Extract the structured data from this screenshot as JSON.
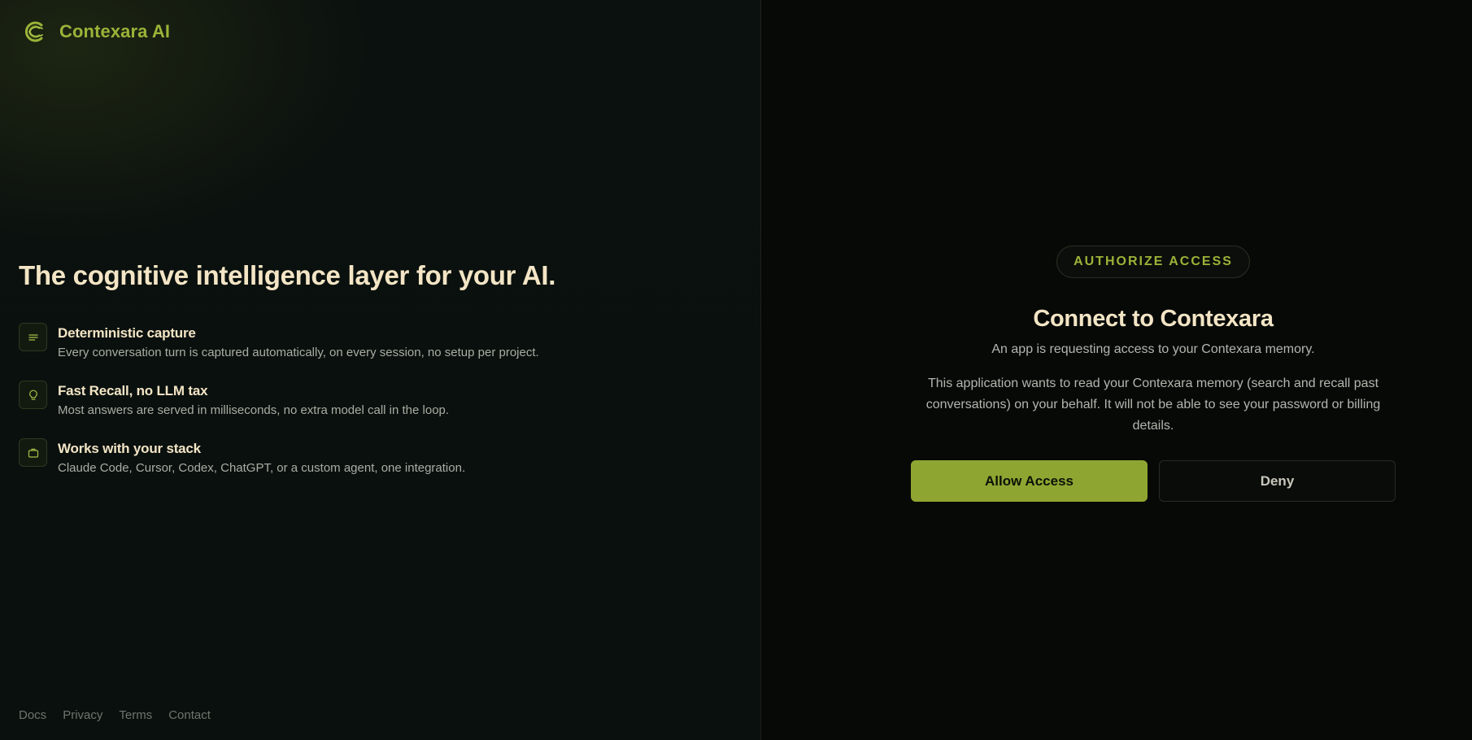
{
  "brand": {
    "name": "Contexara AI",
    "color": "#9bb338"
  },
  "hero": {
    "headline": "The cognitive intelligence layer for your AI."
  },
  "features": [
    {
      "icon": "lines-icon",
      "title": "Deterministic capture",
      "description": "Every conversation turn is captured automatically, on every session, no setup per project."
    },
    {
      "icon": "lightbulb-icon",
      "title": "Fast Recall, no LLM tax",
      "description": "Most answers are served in milliseconds, no extra model call in the loop."
    },
    {
      "icon": "briefcase-icon",
      "title": "Works with your stack",
      "description": "Claude Code, Cursor, Codex, ChatGPT, or a custom agent, one integration."
    }
  ],
  "footer": {
    "links": [
      "Docs",
      "Privacy",
      "Terms",
      "Contact"
    ]
  },
  "auth": {
    "badge": "AUTHORIZE ACCESS",
    "title": "Connect to Contexara",
    "subtitle": "An app is requesting access to your Contexara memory.",
    "description": "This application wants to read your Contexara memory (search and recall past conversations) on your behalf. It will not be able to see your password or billing details.",
    "allow_label": "Allow Access",
    "deny_label": "Deny",
    "accent_color": "#8ea631"
  }
}
